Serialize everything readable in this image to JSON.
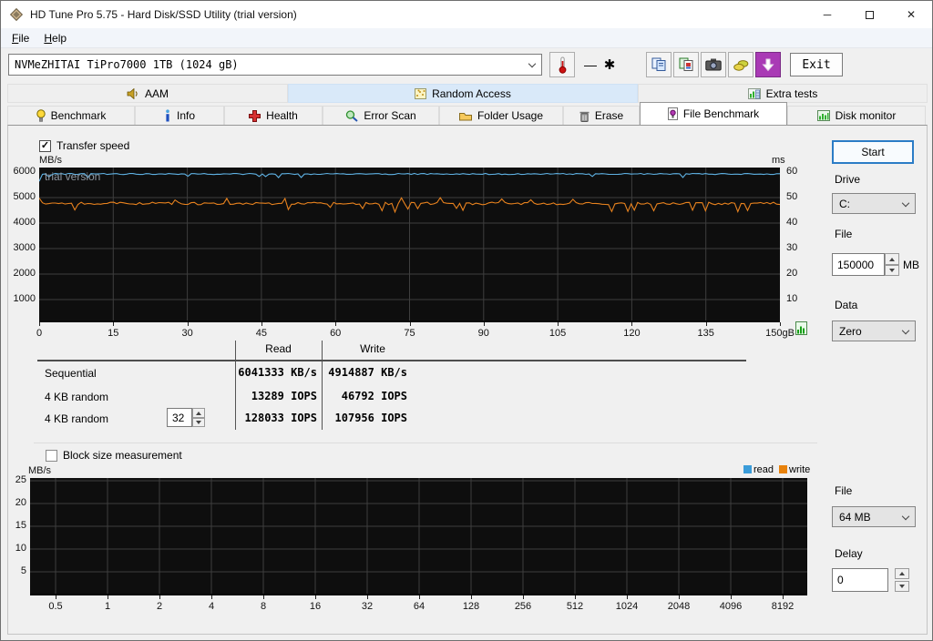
{
  "window": {
    "title": "HD Tune Pro 5.75 - Hard Disk/SSD Utility (trial version)"
  },
  "icons": {
    "minimize": "─",
    "close": "✕",
    "dash": "—",
    "star": "✱",
    "check": "✓"
  },
  "menu": {
    "items": [
      {
        "label": "File"
      },
      {
        "label": "Help"
      }
    ]
  },
  "toolbar": {
    "device": "NVMeZHITAI TiPro7000 1TB (1024 gB)",
    "exit": "Exit"
  },
  "tabs_row1": [
    {
      "label": "AAM"
    },
    {
      "label": "Random Access"
    },
    {
      "label": "Extra tests"
    }
  ],
  "tabs_row2": [
    {
      "label": "Benchmark"
    },
    {
      "label": "Info"
    },
    {
      "label": "Health"
    },
    {
      "label": "Error Scan"
    },
    {
      "label": "Folder Usage"
    },
    {
      "label": "Erase"
    },
    {
      "label": "File Benchmark",
      "active": true
    },
    {
      "label": "Disk monitor"
    }
  ],
  "file_benchmark": {
    "transfer_speed": {
      "label": "Transfer speed",
      "checked": true
    },
    "watermark": "trial version",
    "results": {
      "col_read": "Read",
      "col_write": "Write",
      "queue_depth": "32",
      "rows": [
        {
          "label": "Sequential",
          "read": "6041333 KB/s",
          "write": "4914887 KB/s"
        },
        {
          "label": "4 KB random",
          "read": "13289 IOPS",
          "write": "46792 IOPS"
        },
        {
          "label": "4 KB random",
          "read": "128033 IOPS",
          "write": "107956 IOPS"
        }
      ]
    },
    "block_size": {
      "label": "Block size measurement",
      "checked": false
    },
    "legend": {
      "read": "read",
      "read_color": "#3b9cd9",
      "write": "write",
      "write_color": "#e8820c"
    }
  },
  "panel": {
    "start": "Start",
    "drive_label": "Drive",
    "drive_value": "C:",
    "file_label": "File",
    "file_value": "150000",
    "file_unit": "MB",
    "data_label": "Data",
    "data_value": "Zero",
    "file2_label": "File",
    "file2_value": "64 MB",
    "delay_label": "Delay",
    "delay_value": "0"
  },
  "chart_data": [
    {
      "type": "line",
      "title": "Transfer speed",
      "y_left": {
        "label": "MB/s",
        "ticks": [
          6000,
          5000,
          4000,
          3000,
          2000,
          1000
        ],
        "range": [
          0,
          6200
        ]
      },
      "y_right": {
        "label": "ms",
        "ticks": [
          60,
          50,
          40,
          30,
          20,
          10
        ],
        "range": [
          0,
          62
        ]
      },
      "x": {
        "ticks": [
          "0",
          "15",
          "30",
          "45",
          "60",
          "75",
          "90",
          "105",
          "120",
          "135",
          "150gB"
        ],
        "range_gb": [
          0,
          150
        ]
      },
      "grid": true,
      "background": "#0e0e0e",
      "gridline_color": "#3e3e3e",
      "watermark": "trial version",
      "points_per_series": 230,
      "series": [
        {
          "name": "read",
          "color": "#5fb2e4",
          "unit": "MB/s",
          "approx_avg": 5925,
          "approx_min": 5700,
          "approx_max": 5980,
          "start": 5250,
          "jitter": 22,
          "dip_chance": 0.05,
          "dip_min": 80,
          "dip_max": 150,
          "up_chance": 0,
          "up_min": 0,
          "up_max": 0,
          "seed": 42
        },
        {
          "name": "write",
          "color": "#e8821e",
          "unit": "MB/s",
          "approx_avg": 4770,
          "approx_min": 4400,
          "approx_max": 5050,
          "start": 4980,
          "jitter": 50,
          "dip_chance": 0.1,
          "dip_min": 180,
          "dip_max": 330,
          "up_chance": 0.05,
          "up_min": 150,
          "up_max": 230,
          "seed": 1337
        }
      ]
    },
    {
      "type": "line",
      "title": "Block size measurement",
      "y_left": {
        "label": "MB/s",
        "ticks": [
          25,
          20,
          15,
          10,
          5
        ],
        "range": [
          0,
          25
        ]
      },
      "x": {
        "ticks": [
          "0.5",
          "1",
          "2",
          "4",
          "8",
          "16",
          "32",
          "64",
          "128",
          "256",
          "512",
          "1024",
          "2048",
          "4096",
          "8192"
        ],
        "unit": "KB"
      },
      "grid": true,
      "background": "#0e0e0e",
      "gridline_color": "#3e3e3e",
      "legend": [
        "read",
        "write"
      ],
      "series": []
    }
  ]
}
